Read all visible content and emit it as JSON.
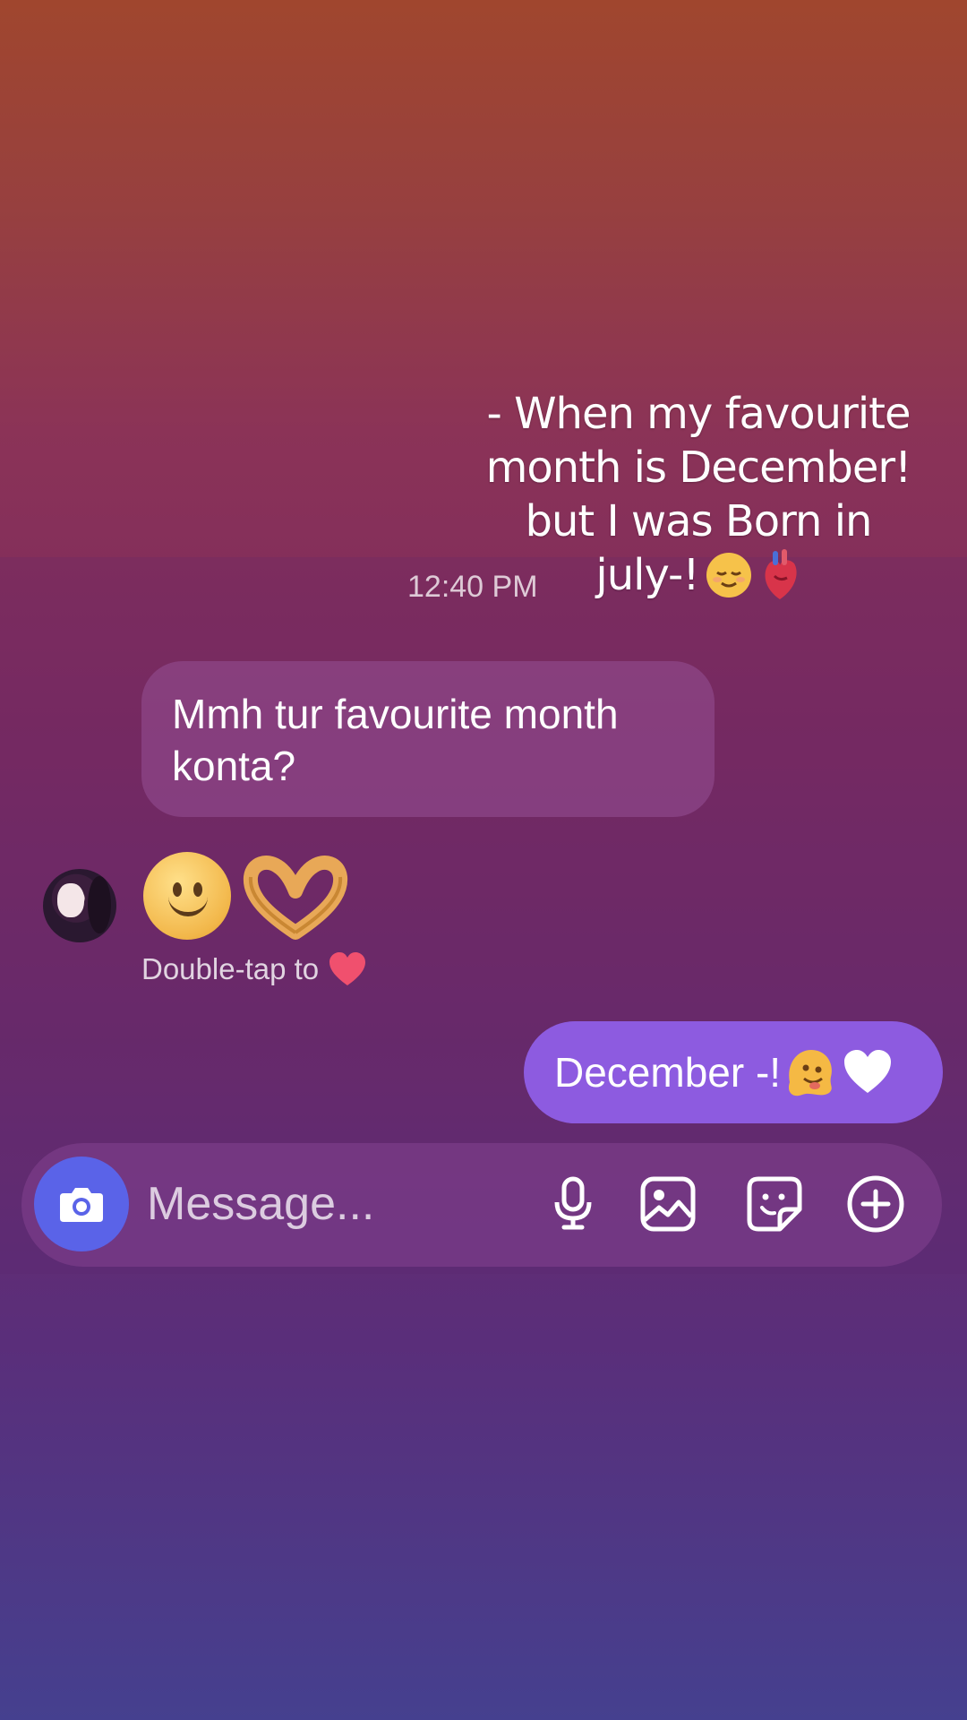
{
  "caption": {
    "line1": "- When my favourite",
    "line2": "month is December!",
    "line3": "but I was Born in",
    "line4": "july-!"
  },
  "thread": {
    "timestamp": "12:40 PM",
    "received_message_line1": "Mmh tur favourite month",
    "received_message_line2": "konta?",
    "double_tap_hint": "Double-tap to",
    "sent_message": "December -!"
  },
  "composer": {
    "placeholder": "Message..."
  },
  "icons": {
    "caption_emojis": [
      "relieved-face",
      "anatomical-heart"
    ],
    "reaction_emojis": [
      "slightly-smiling-face",
      "heart-hands"
    ],
    "sent_emojis": [
      "melting-face",
      "white-heart"
    ],
    "composer": [
      "camera-icon",
      "microphone-icon",
      "image-icon",
      "sticker-icon",
      "plus-icon"
    ]
  },
  "colors": {
    "sent_bubble": "#8d5be0",
    "camera_button": "#5a63e8",
    "hint_heart": "#f0506e"
  }
}
